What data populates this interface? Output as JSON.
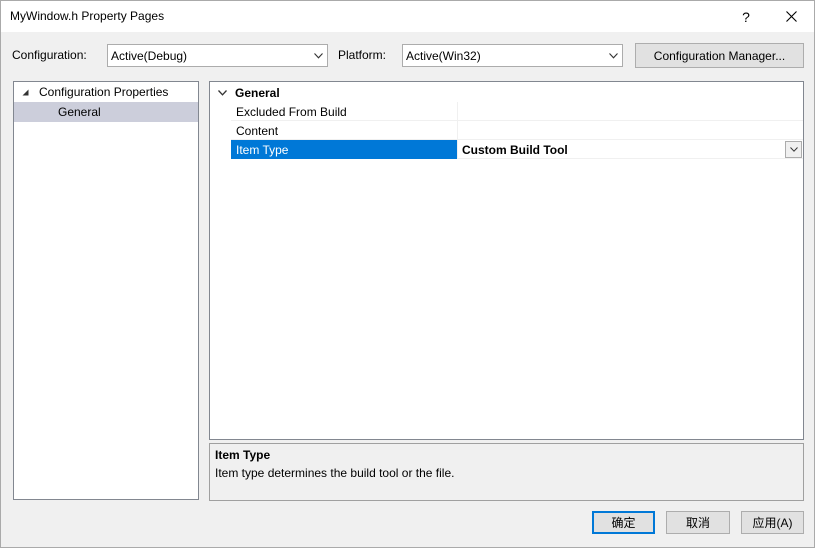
{
  "window": {
    "title": "MyWindow.h Property Pages",
    "help_glyph": "?",
    "close_icon": "close-icon"
  },
  "toolbar": {
    "configuration_label": "Configuration:",
    "configuration_value": "Active(Debug)",
    "platform_label": "Platform:",
    "platform_value": "Active(Win32)",
    "config_manager_label": "Configuration Manager..."
  },
  "tree": {
    "items": [
      {
        "label": "Configuration Properties",
        "expanded": true,
        "level": 0
      },
      {
        "label": "General",
        "selected": true,
        "level": 1
      }
    ]
  },
  "grid": {
    "category": "General",
    "properties": [
      {
        "name": "Excluded From Build",
        "value": ""
      },
      {
        "name": "Content",
        "value": ""
      },
      {
        "name": "Item Type",
        "value": "Custom Build Tool",
        "selected": true
      }
    ]
  },
  "description": {
    "title": "Item Type",
    "text": "Item type determines the build tool or the file."
  },
  "buttons": {
    "ok": "确定",
    "cancel": "取消",
    "apply": "应用(A)"
  },
  "colors": {
    "selection": "#0078d7",
    "tree_selection": "#cccedb",
    "dialog_bg": "#f0f0f0"
  }
}
